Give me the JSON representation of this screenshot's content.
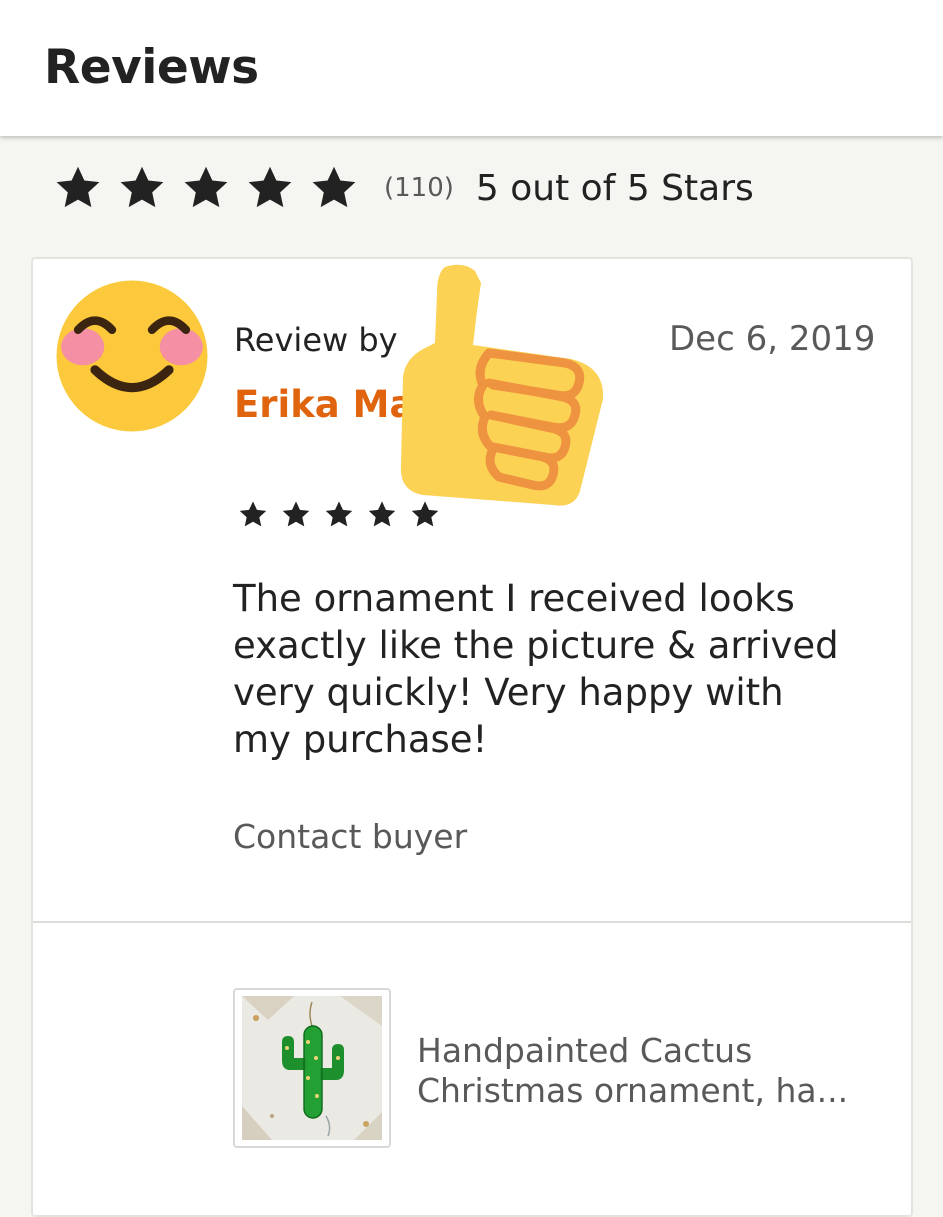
{
  "header": {
    "title": "Reviews"
  },
  "summary": {
    "rating": 5,
    "max_rating": 5,
    "count": "(110)",
    "text": "5 out of 5 Stars",
    "star_icon": "star-icon",
    "star_color": "#222222"
  },
  "review": {
    "avatar_icon": "smiling-face-icon",
    "overlay_icon": "thumbs-up-icon",
    "review_by_label": "Review by",
    "reviewer_name": "Erika Mar",
    "date": "Dec 6, 2019",
    "rating": 5,
    "text": "The ornament I received looks exactly like the picture & arrived very quickly! Very happy with my purchase!",
    "contact_label": "Contact buyer",
    "name_color": "#e0630e"
  },
  "product": {
    "image_icon": "cactus-ornament-image",
    "title": "Handpainted Cactus Christmas ornament, ha..."
  }
}
